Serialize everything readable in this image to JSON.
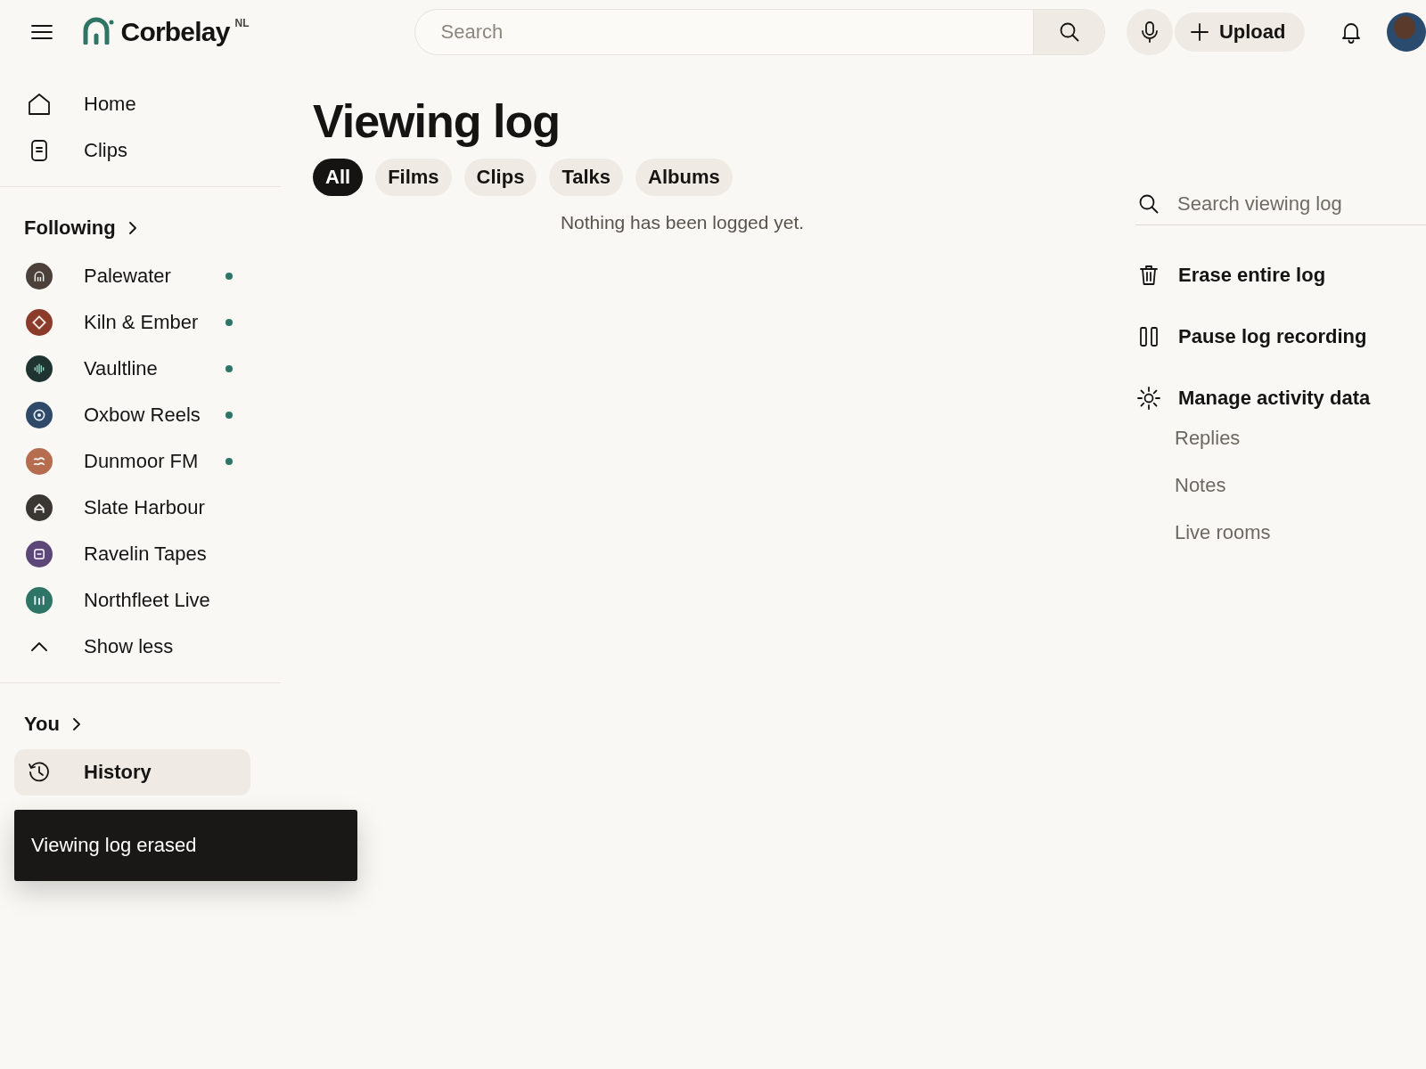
{
  "top_bar": {
    "brand": "Corbelay",
    "region": "NL",
    "search": {
      "placeholder": "Search"
    },
    "upload_button": "Upload"
  },
  "sidebar": {
    "nav": [
      {
        "label": "Home",
        "selected": false
      },
      {
        "label": "Clips",
        "selected": false
      }
    ],
    "following": {
      "heading": "Following",
      "channels": [
        {
          "name": "Palewater",
          "color": "#4b403a",
          "live": true
        },
        {
          "name": "Kiln & Ember",
          "color": "#8b3b29",
          "live": true
        },
        {
          "name": "Vaultline",
          "color": "#1f3431",
          "live": true
        },
        {
          "name": "Oxbow Reels",
          "color": "#2f4a69",
          "live": true
        },
        {
          "name": "Dunmoor FM",
          "color": "#b56c4f",
          "live": true
        },
        {
          "name": "Slate Harbour",
          "color": "#3a3632",
          "live": false
        },
        {
          "name": "Ravelin Tapes",
          "color": "#5c4878",
          "live": false
        },
        {
          "name": "Northfleet Live",
          "color": "#2f7566",
          "live": false
        }
      ],
      "show_less": "Show less"
    },
    "you": {
      "heading": "You",
      "items": [
        {
          "label": "History",
          "selected": true
        }
      ]
    }
  },
  "main": {
    "title": "Viewing log",
    "filters": [
      {
        "label": "All",
        "selected": true
      },
      {
        "label": "Films",
        "selected": false
      },
      {
        "label": "Clips",
        "selected": false
      },
      {
        "label": "Talks",
        "selected": false
      },
      {
        "label": "Albums",
        "selected": false
      }
    ],
    "empty_message": "Nothing has been logged yet."
  },
  "panel": {
    "search": {
      "placeholder": "Search viewing log"
    },
    "actions": [
      {
        "label": "Erase entire log"
      },
      {
        "label": "Pause log recording"
      },
      {
        "label": "Manage activity data"
      }
    ],
    "subitems": [
      {
        "label": "Replies"
      },
      {
        "label": "Notes"
      },
      {
        "label": "Live rooms"
      }
    ]
  },
  "toast": {
    "message": "Viewing log erased"
  }
}
